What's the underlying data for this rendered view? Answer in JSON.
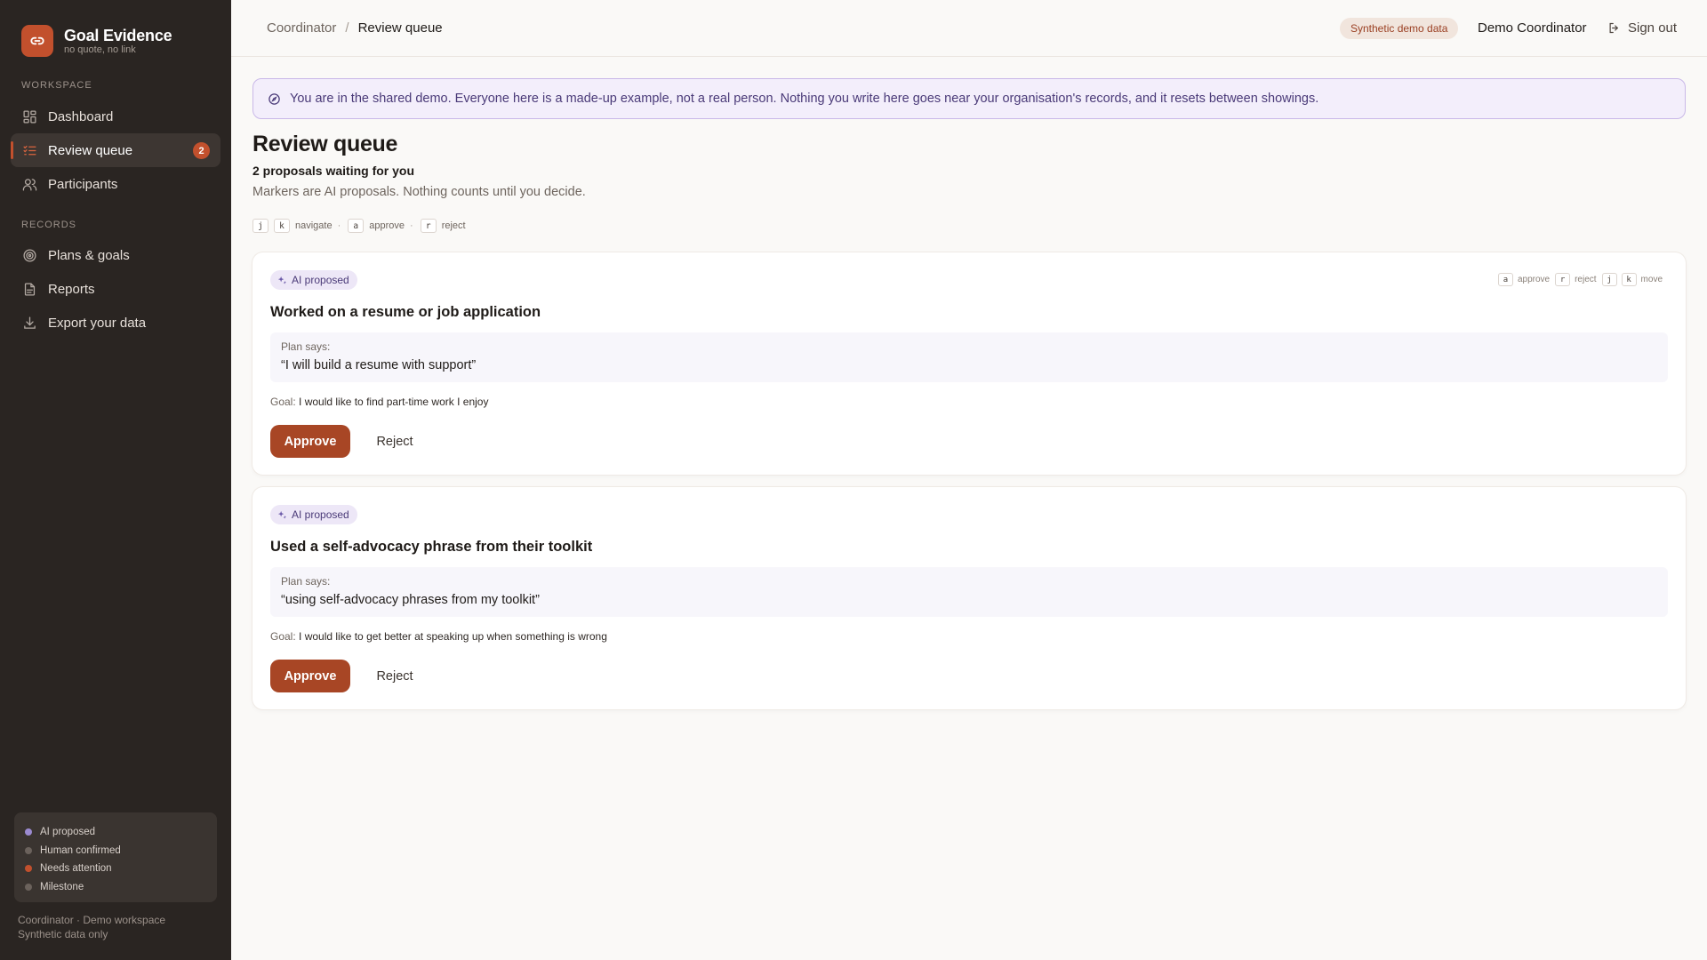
{
  "app": {
    "name": "Goal Evidence",
    "tagline": "no quote, no link",
    "logo_icon": "link-icon",
    "accent": "#c2502d"
  },
  "sidebar": {
    "workspace_label": "WORKSPACE",
    "workspace_items": [
      {
        "label": "Dashboard",
        "icon": "grid-icon"
      },
      {
        "label": "Review queue",
        "icon": "list-check-icon",
        "badge": "2",
        "active": true
      },
      {
        "label": "Participants",
        "icon": "users-icon"
      }
    ],
    "records_label": "RECORDS",
    "records_items": [
      {
        "label": "Plans & goals",
        "icon": "target-icon"
      },
      {
        "label": "Reports",
        "icon": "document-icon"
      },
      {
        "label": "Export your data",
        "icon": "download-icon"
      }
    ],
    "legend": [
      {
        "label": "AI proposed",
        "color": "#9b8ad0"
      },
      {
        "label": "Human confirmed",
        "color": "#6b625c"
      },
      {
        "label": "Needs attention",
        "color": "#c2502d"
      },
      {
        "label": "Milestone",
        "color": "#6b625c"
      }
    ],
    "footer_line1": "Coordinator · Demo workspace",
    "footer_line2": "Synthetic data only"
  },
  "topbar": {
    "breadcrumb_parent": "Coordinator",
    "breadcrumb_sep": "/",
    "breadcrumb_current": "Review queue",
    "demo_pill": "Synthetic demo data",
    "user_name": "Demo Coordinator",
    "sign_out": "Sign out"
  },
  "banner": {
    "text": "You are in the shared demo. Everyone here is a made-up example, not a real person. Nothing you write here goes near your organisation's records, and it resets between showings."
  },
  "page": {
    "title": "Review queue",
    "count": "2 proposals waiting for you",
    "subtitle": "Markers are AI proposals. Nothing counts until you decide.",
    "shortcuts": {
      "k1": "j",
      "k2": "k",
      "navigate": "navigate",
      "dot": "·",
      "k3": "a",
      "approve": "approve",
      "k4": "r",
      "reject": "reject"
    }
  },
  "card_shortcuts": {
    "k_a": "a",
    "approve": "approve",
    "k_r": "r",
    "reject": "reject",
    "k_j": "j",
    "k_k": "k",
    "move": "move"
  },
  "proposals": [
    {
      "chip": "AI proposed",
      "title": "Worked on a resume or job application",
      "plan_label": "Plan says:",
      "plan_quote": "“I will build a resume with support”",
      "goal_label": "Goal:",
      "goal_text": "I would like to find part-time work I enjoy",
      "approve": "Approve",
      "reject": "Reject"
    },
    {
      "chip": "AI proposed",
      "title": "Used a self-advocacy phrase from their toolkit",
      "plan_label": "Plan says:",
      "plan_quote": "“using self-advocacy phrases from my toolkit”",
      "goal_label": "Goal:",
      "goal_text": "I would like to get better at speaking up when something is wrong",
      "approve": "Approve",
      "reject": "Reject"
    }
  ]
}
